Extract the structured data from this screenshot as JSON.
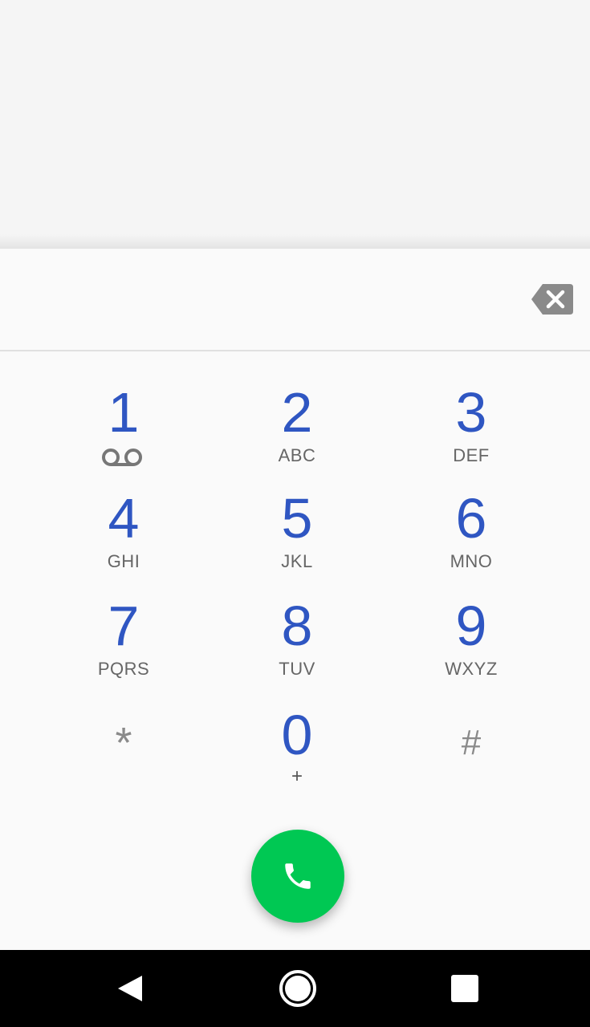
{
  "dialer": {
    "digits_value": "",
    "keys": [
      {
        "digit": "1",
        "letters": ""
      },
      {
        "digit": "2",
        "letters": "ABC"
      },
      {
        "digit": "3",
        "letters": "DEF"
      },
      {
        "digit": "4",
        "letters": "GHI"
      },
      {
        "digit": "5",
        "letters": "JKL"
      },
      {
        "digit": "6",
        "letters": "MNO"
      },
      {
        "digit": "7",
        "letters": "PQRS"
      },
      {
        "digit": "8",
        "letters": "TUV"
      },
      {
        "digit": "9",
        "letters": "WXYZ"
      },
      {
        "symbol": "*"
      },
      {
        "digit": "0",
        "secondary": "+"
      },
      {
        "symbol": "#"
      }
    ],
    "icons": {
      "voicemail": "voicemail-icon",
      "backspace": "backspace-icon",
      "call": "phone-icon"
    }
  },
  "navbar": {
    "icons": [
      "back-icon",
      "home-icon",
      "recents-icon"
    ]
  },
  "colors": {
    "digit": "#2f56c2",
    "call_button": "#00c853",
    "navbar": "#000000"
  }
}
